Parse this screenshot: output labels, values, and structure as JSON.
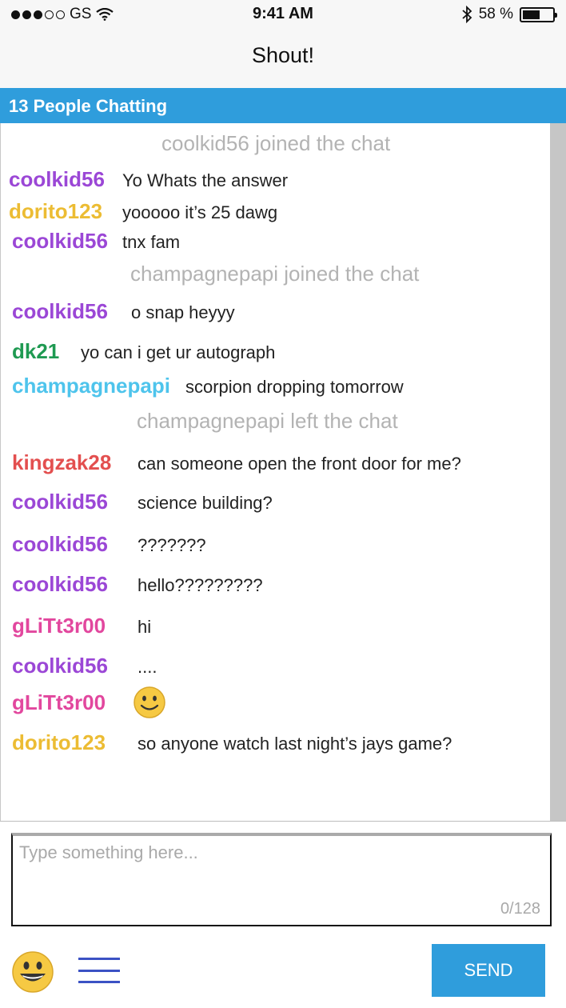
{
  "status_bar": {
    "carrier": "GS",
    "time": "9:41 AM",
    "battery": "58 %",
    "battery_level": 0.58,
    "icons": [
      "signal-dots-icon",
      "wifi-icon",
      "bluetooth-icon",
      "battery-icon"
    ]
  },
  "nav": {
    "title": "Shout!"
  },
  "header": {
    "people_chatting": "13 People Chatting"
  },
  "colors": {
    "accent": "#2f9ddc",
    "purple": "#9b47d6",
    "yellow": "#ecbc33",
    "green": "#1f9a52",
    "cyan": "#4ec4ec",
    "red": "#e34f4f",
    "pink": "#e2479e",
    "system": "#b3b3b3"
  },
  "messages": [
    {
      "type": "system",
      "text": "coolkid56 joined the chat"
    },
    {
      "type": "chat",
      "user": "coolkid56",
      "color": "purple",
      "text": "Yo Whats the answer"
    },
    {
      "type": "chat",
      "user": "dorito123",
      "color": "yellow",
      "text": "yooooo it’s 25 dawg"
    },
    {
      "type": "chat",
      "user": "coolkid56",
      "color": "purple",
      "text": "tnx fam"
    },
    {
      "type": "system",
      "text": "champagnepapi joined the chat"
    },
    {
      "type": "chat",
      "user": "coolkid56",
      "color": "purple",
      "text": "o snap heyyy"
    },
    {
      "type": "chat",
      "user": "dk21",
      "color": "green",
      "text": "yo can i get ur autograph"
    },
    {
      "type": "chat",
      "user": "champagnepapi",
      "color": "cyan",
      "text": "scorpion dropping tomorrow"
    },
    {
      "type": "system",
      "text": "champagnepapi left the chat"
    },
    {
      "type": "chat",
      "user": "kingzak28",
      "color": "red",
      "text": "can someone open the front door for me?"
    },
    {
      "type": "chat",
      "user": "coolkid56",
      "color": "purple",
      "text": "science building?"
    },
    {
      "type": "chat",
      "user": "coolkid56",
      "color": "purple",
      "text": "???????"
    },
    {
      "type": "chat",
      "user": "coolkid56",
      "color": "purple",
      "text": "hello?????????"
    },
    {
      "type": "chat",
      "user": "gLiTt3r00",
      "color": "pink",
      "text": "hi"
    },
    {
      "type": "chat",
      "user": "coolkid56",
      "color": "purple",
      "text": "...."
    },
    {
      "type": "chat",
      "user": "gLiTt3r00",
      "color": "pink",
      "emoji": "smiley-face-icon"
    },
    {
      "type": "chat",
      "user": "dorito123",
      "color": "yellow",
      "text": "so anyone watch last night’s jays game?"
    }
  ],
  "composer": {
    "placeholder": "Type something here...",
    "value": "",
    "counter": "0/128",
    "send_label": "SEND",
    "emoji_button_icon": "smiley-face-icon",
    "menu_button_icon": "hamburger-menu-icon"
  }
}
